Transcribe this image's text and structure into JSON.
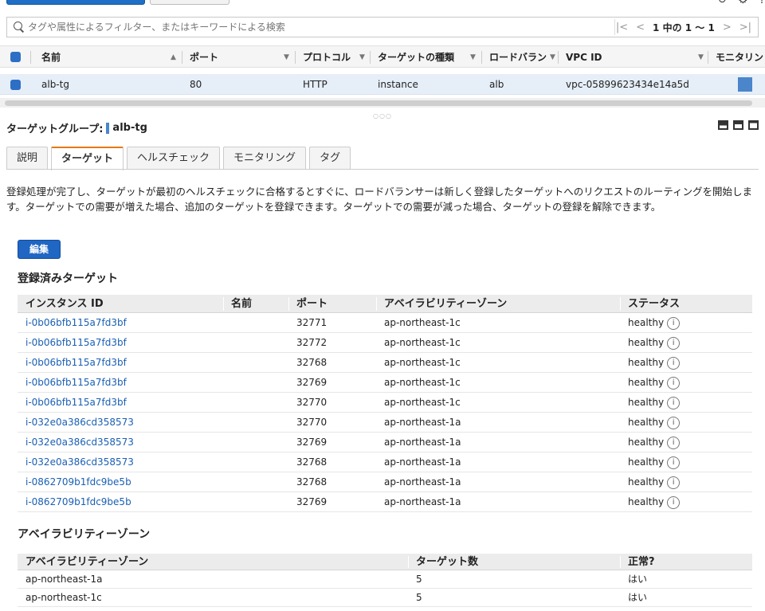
{
  "search": {
    "placeholder": "タグや属性によるフィルター、またはキーワードによる検索"
  },
  "pager": {
    "text": "1 中の 1 〜 1"
  },
  "main_table": {
    "headers": {
      "name": "名前",
      "port": "ポート",
      "protocol": "プロトコル",
      "target_type": "ターゲットの種類",
      "lb": "ロードバラン",
      "vpc": "VPC ID",
      "monitor": "モニタリン"
    },
    "row": {
      "name": "alb-tg",
      "port": "80",
      "protocol": "HTTP",
      "target_type": "instance",
      "lb": "alb",
      "vpc": "vpc-05899623434e14a5d"
    }
  },
  "detail": {
    "title_label": "ターゲットグループ:",
    "title_value": "alb-tg",
    "tabs": [
      "説明",
      "ターゲット",
      "ヘルスチェック",
      "モニタリング",
      "タグ"
    ],
    "description": "登録処理が完了し、ターゲットが最初のヘルスチェックに合格するとすぐに、ロードバランサーは新しく登録したターゲットへのリクエストのルーティングを開始します。ターゲットでの需要が増えた場合、追加のターゲットを登録できます。ターゲットでの需要が減った場合、ターゲットの登録を解除できます。",
    "edit_label": "編集"
  },
  "registered": {
    "title": "登録済みターゲット",
    "headers": {
      "instance": "インスタンス ID",
      "name": "名前",
      "port": "ポート",
      "az": "アベイラビリティーゾーン",
      "status": "ステータス"
    },
    "rows": [
      {
        "instance": "i-0b06bfb115a7fd3bf",
        "port": "32771",
        "az": "ap-northeast-1c",
        "status": "healthy"
      },
      {
        "instance": "i-0b06bfb115a7fd3bf",
        "port": "32772",
        "az": "ap-northeast-1c",
        "status": "healthy"
      },
      {
        "instance": "i-0b06bfb115a7fd3bf",
        "port": "32768",
        "az": "ap-northeast-1c",
        "status": "healthy"
      },
      {
        "instance": "i-0b06bfb115a7fd3bf",
        "port": "32769",
        "az": "ap-northeast-1c",
        "status": "healthy"
      },
      {
        "instance": "i-0b06bfb115a7fd3bf",
        "port": "32770",
        "az": "ap-northeast-1c",
        "status": "healthy"
      },
      {
        "instance": "i-032e0a386cd358573",
        "port": "32770",
        "az": "ap-northeast-1a",
        "status": "healthy"
      },
      {
        "instance": "i-032e0a386cd358573",
        "port": "32769",
        "az": "ap-northeast-1a",
        "status": "healthy"
      },
      {
        "instance": "i-032e0a386cd358573",
        "port": "32768",
        "az": "ap-northeast-1a",
        "status": "healthy"
      },
      {
        "instance": "i-0862709b1fdc9be5b",
        "port": "32768",
        "az": "ap-northeast-1a",
        "status": "healthy"
      },
      {
        "instance": "i-0862709b1fdc9be5b",
        "port": "32769",
        "az": "ap-northeast-1a",
        "status": "healthy"
      }
    ]
  },
  "az_section": {
    "title": "アベイラビリティーゾーン",
    "headers": {
      "az": "アベイラビリティーゾーン",
      "count": "ターゲット数",
      "healthy": "正常?"
    },
    "rows": [
      {
        "az": "ap-northeast-1a",
        "count": "5",
        "healthy": "はい"
      },
      {
        "az": "ap-northeast-1c",
        "count": "5",
        "healthy": "はい"
      }
    ]
  },
  "icons": {
    "info": "i",
    "refresh": "↻",
    "settings": "⚙",
    "help": "?"
  }
}
